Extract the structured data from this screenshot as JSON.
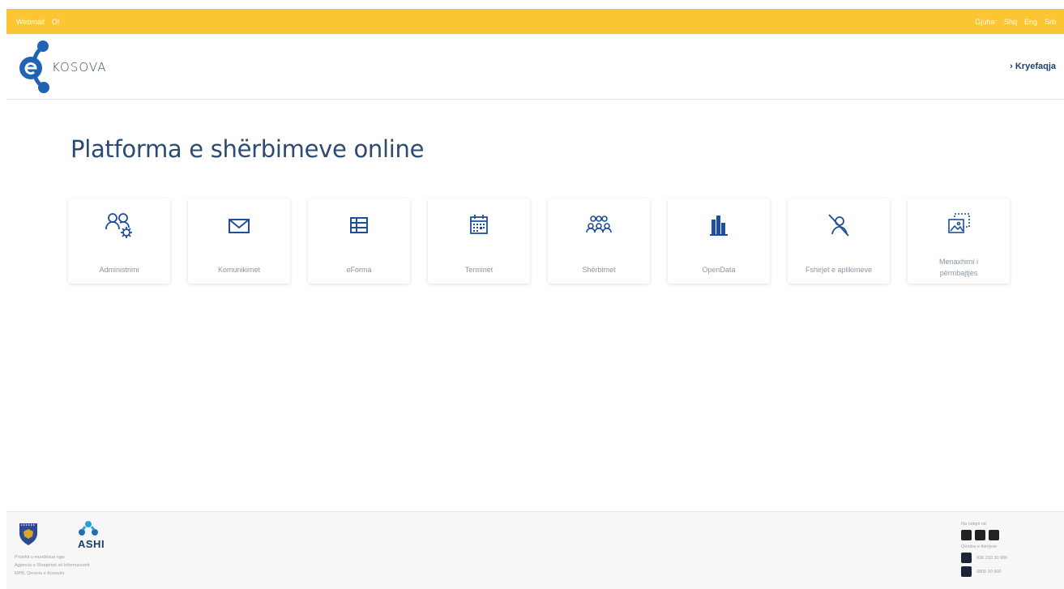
{
  "topbar": {
    "links_left": [
      "Webmail",
      "OI"
    ],
    "language_label": "Gjuha:",
    "languages": [
      "Shq",
      "Eng",
      "Srb"
    ]
  },
  "header": {
    "logo_text": "KOSOVA",
    "home_link": "› Kryefaqja"
  },
  "page_title": "Platforma e shërbimeve online",
  "tiles": [
    {
      "label": "Administrimi",
      "icon": "admin-users-gear-icon"
    },
    {
      "label": "Komunikimet",
      "icon": "envelope-icon"
    },
    {
      "label": "eForma",
      "icon": "form-table-icon"
    },
    {
      "label": "Terminet",
      "icon": "calendar-icon"
    },
    {
      "label": "Shërbimet",
      "icon": "group-people-icon"
    },
    {
      "label": "OpenData",
      "icon": "bar-chart-icon"
    },
    {
      "label": "Fshirjet e aplikimeve",
      "icon": "delete-person-icon"
    },
    {
      "label_line1": "Menaxhimi i",
      "label_line2": "përmbajtjes",
      "icon": "content-images-icon"
    }
  ],
  "footer": {
    "credits_1": "Projekti u mundësua nga:",
    "credits_2": "Agjencia e Shoqërisë së Informacionit",
    "credits_3": "MPB, Qeveria e Kosovës",
    "ashi": "ASHI",
    "follow_label": "Na ndiqni në:",
    "call_center_label": "Qendra e thirrjeve",
    "phone_1": "038 200 30 900",
    "phone_2": "0800 30 900"
  },
  "colors": {
    "topbar": "#fcc534",
    "brand_blue": "#2c4a72",
    "icon_blue": "#1f4f9c"
  }
}
